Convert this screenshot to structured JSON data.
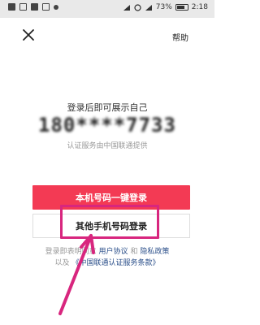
{
  "status_bar": {
    "battery_text": "73%",
    "time": "2:18"
  },
  "header": {
    "close_icon": "close-icon",
    "help_label": "帮助"
  },
  "main": {
    "subtitle": "登录后即可展示自己",
    "phone_number": "180****7733",
    "provider_note": "认证服务由中国联通提供",
    "primary_button": "本机号码一键登录",
    "secondary_button": "其他手机号码登录"
  },
  "agreement": {
    "prefix": "登录即表明同意",
    "user_agreement": "用户协议",
    "and": "和",
    "privacy_policy": "隐私政策",
    "prefix2": "以及",
    "service_terms": "《中国联通认证服务条款》"
  },
  "annotation": {
    "highlight_color": "#d8267e"
  }
}
